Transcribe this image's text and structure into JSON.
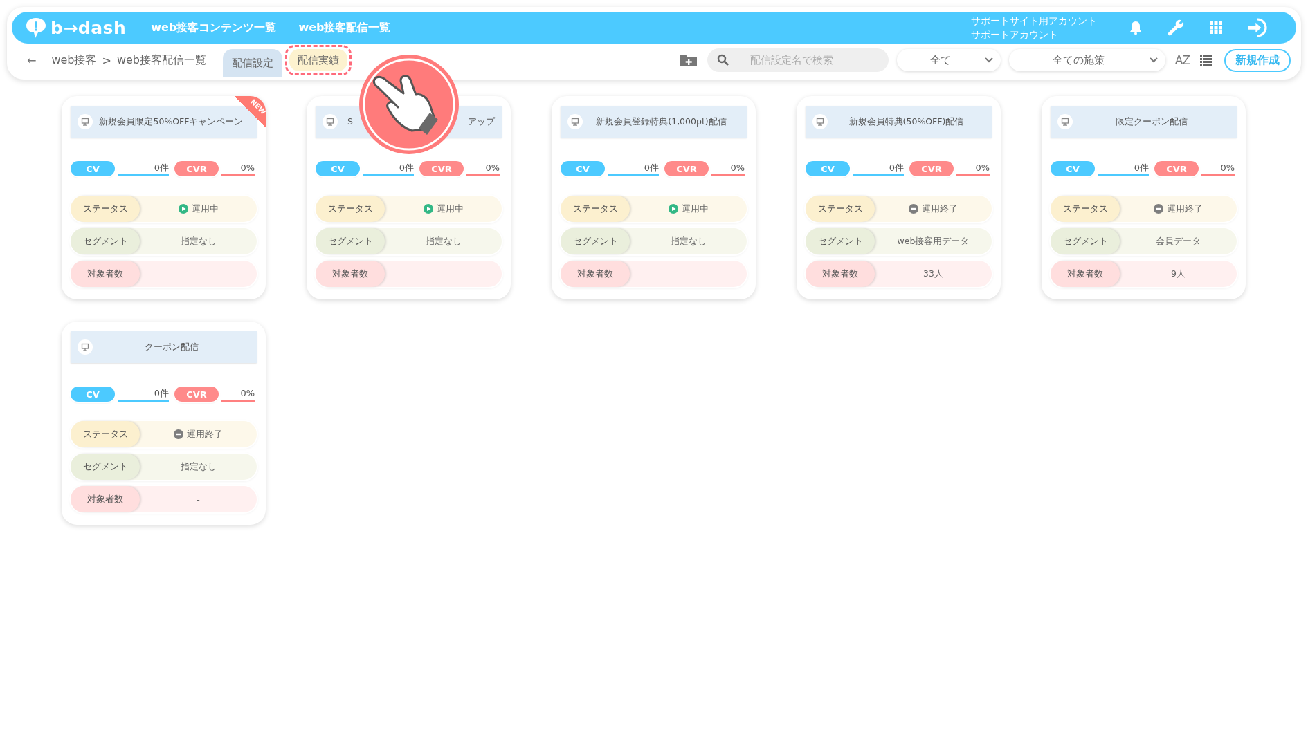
{
  "header": {
    "logo": "b→dash",
    "nav": [
      {
        "label": "web接客コンテンツ一覧"
      },
      {
        "label": "web接客配信一覧"
      }
    ],
    "account": [
      "サポートサイト用アカウント",
      "サポートアカウント"
    ]
  },
  "toolbar": {
    "back": "←",
    "breadcrumb": [
      "web接客",
      ">",
      "web接客配信一覧"
    ],
    "tabs": [
      {
        "label": "配信設定",
        "selected": true,
        "highlighted": false
      },
      {
        "label": "配信実績",
        "selected": false,
        "highlighted": true
      }
    ],
    "search": {
      "placeholder": "配信設定名で検索"
    },
    "filters": [
      {
        "value": "全て"
      },
      {
        "value": "全ての施策"
      }
    ],
    "sort": "AZ",
    "new_button": "新規作成"
  },
  "cards": [
    {
      "title": "新規会員限定50%OFFキャンペーン",
      "badge": "NEW",
      "cv_label": "CV",
      "cv": "0件",
      "cvr_label": "CVR",
      "cvr": "0%",
      "rows": [
        {
          "kind": "status",
          "label": "ステータス",
          "value": "運用中",
          "active": true
        },
        {
          "kind": "segment",
          "label": "セグメント",
          "value": "指定なし"
        },
        {
          "kind": "target",
          "label": "対象者数",
          "value": "-"
        }
      ]
    },
    {
      "title_parts": [
        "S",
        "アップ"
      ],
      "cv_label": "CV",
      "cv": "0件",
      "cvr_label": "CVR",
      "cvr": "0%",
      "rows": [
        {
          "kind": "status",
          "label": "ステータス",
          "value": "運用中",
          "active": true
        },
        {
          "kind": "segment",
          "label": "セグメント",
          "value": "指定なし"
        },
        {
          "kind": "target",
          "label": "対象者数",
          "value": "-"
        }
      ]
    },
    {
      "title": "新規会員登録特典(1,000pt)配信",
      "cv_label": "CV",
      "cv": "0件",
      "cvr_label": "CVR",
      "cvr": "0%",
      "rows": [
        {
          "kind": "status",
          "label": "ステータス",
          "value": "運用中",
          "active": true
        },
        {
          "kind": "segment",
          "label": "セグメント",
          "value": "指定なし"
        },
        {
          "kind": "target",
          "label": "対象者数",
          "value": "-"
        }
      ]
    },
    {
      "title": "新規会員特典(50%OFF)配信",
      "cv_label": "CV",
      "cv": "0件",
      "cvr_label": "CVR",
      "cvr": "0%",
      "rows": [
        {
          "kind": "status",
          "label": "ステータス",
          "value": "運用終了",
          "active": false
        },
        {
          "kind": "segment",
          "label": "セグメント",
          "value": "web接客用データ"
        },
        {
          "kind": "target",
          "label": "対象者数",
          "value": "33人"
        }
      ]
    },
    {
      "title": "限定クーポン配信",
      "cv_label": "CV",
      "cv": "0件",
      "cvr_label": "CVR",
      "cvr": "0%",
      "rows": [
        {
          "kind": "status",
          "label": "ステータス",
          "value": "運用終了",
          "active": false
        },
        {
          "kind": "segment",
          "label": "セグメント",
          "value": "会員データ"
        },
        {
          "kind": "target",
          "label": "対象者数",
          "value": "9人"
        }
      ]
    },
    {
      "title": "クーポン配信",
      "cv_label": "CV",
      "cv": "0件",
      "cvr_label": "CVR",
      "cvr": "0%",
      "rows": [
        {
          "kind": "status",
          "label": "ステータス",
          "value": "運用終了",
          "active": false
        },
        {
          "kind": "segment",
          "label": "セグメント",
          "value": "指定なし"
        },
        {
          "kind": "target",
          "label": "対象者数",
          "value": "-"
        }
      ]
    }
  ]
}
